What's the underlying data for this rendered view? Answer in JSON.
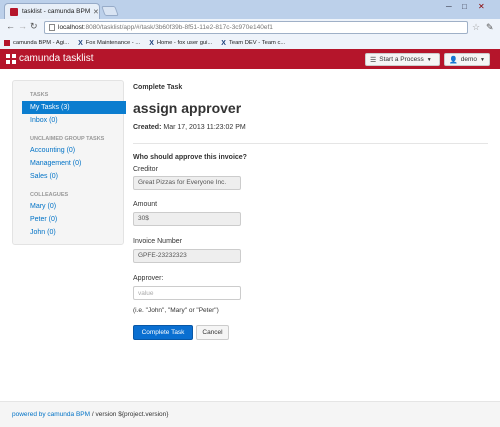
{
  "browser": {
    "tab_title": "tasklist - camunda BPM",
    "url_host": "localhost",
    "url_path": ":8080/tasklist/app/#/task/3b60f39b-8f51-11e2-817c-3c970e140ef1",
    "bookmarks": [
      {
        "label": "camunda BPM - Agi...",
        "icon": "red"
      },
      {
        "label": "Fox Maintenance - ...",
        "icon": "x"
      },
      {
        "label": "Home - fox user gui...",
        "icon": "x"
      },
      {
        "label": "Team DEV - Team c...",
        "icon": "x"
      }
    ]
  },
  "app": {
    "brand": "camunda tasklist",
    "brand_color": "#b5152b",
    "start_process_label": "Start a Process",
    "user_label": "demo"
  },
  "sidebar": {
    "tasks_heading": "TASKS",
    "my_tasks": "My Tasks (3)",
    "inbox": "Inbox (0)",
    "group_heading": "UNCLAIMED GROUP TASKS",
    "groups": [
      "Accounting (0)",
      "Management (0)",
      "Sales (0)"
    ],
    "colleagues_heading": "COLLEAGUES",
    "colleagues": [
      "Mary (0)",
      "Peter (0)",
      "John (0)"
    ]
  },
  "task": {
    "subtitle": "Complete Task",
    "title": "assign approver",
    "created_label": "Created:",
    "created_value": "Mar 17, 2013 11:23:02 PM",
    "question": "Who should approve this invoice?",
    "creditor_label": "Creditor",
    "creditor_value": "Great Pizzas for Everyone Inc.",
    "amount_label": "Amount",
    "amount_value": "30$",
    "invoice_label": "Invoice Number",
    "invoice_value": "GPFE-23232323",
    "approver_label": "Approver:",
    "approver_placeholder": "value",
    "hint": "(i.e. \"John\", \"Mary\" or \"Peter\")",
    "complete_label": "Complete Task",
    "cancel_label": "Cancel"
  },
  "footer": {
    "link": "powered by camunda BPM",
    "version": " / version ${project.version}"
  }
}
